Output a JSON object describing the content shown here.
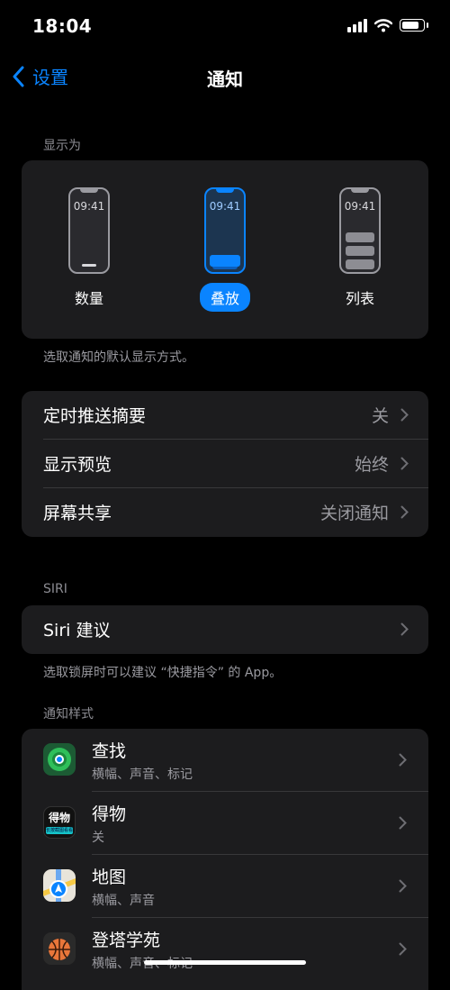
{
  "status": {
    "time": "18:04"
  },
  "nav": {
    "back_label": "设置",
    "title": "通知"
  },
  "display_as": {
    "header": "显示为",
    "options": [
      {
        "label": "数量",
        "phone_time": "09:41",
        "selected": false
      },
      {
        "label": "叠放",
        "phone_time": "09:41",
        "selected": true
      },
      {
        "label": "列表",
        "phone_time": "09:41",
        "selected": false
      }
    ],
    "footer": "选取通知的默认显示方式。"
  },
  "settings": [
    {
      "label": "定时推送摘要",
      "value": "关"
    },
    {
      "label": "显示预览",
      "value": "始终"
    },
    {
      "label": "屏幕共享",
      "value": "关闭通知"
    }
  ],
  "siri": {
    "header": "SIRI",
    "row_label": "Siri 建议",
    "footer": "选取锁屏时可以建议 “快捷指令” 的 App。"
  },
  "notification_style": {
    "header": "通知样式",
    "apps": [
      {
        "name": "查找",
        "sub": "横幅、声音、标记",
        "icon": "find-my-icon"
      },
      {
        "name": "得物",
        "sub": "关",
        "icon": "dewu-icon",
        "icon_text": "得物",
        "icon_caption": "长按截图看看"
      },
      {
        "name": "地图",
        "sub": "横幅、声音",
        "icon": "maps-icon"
      },
      {
        "name": "登塔学苑",
        "sub": "横幅、声音、标记",
        "icon": "dengta-icon"
      }
    ]
  },
  "colors": {
    "accent": "#0a84ff",
    "group_bg": "#1c1c1e",
    "secondary_text": "#9a9aa0"
  }
}
